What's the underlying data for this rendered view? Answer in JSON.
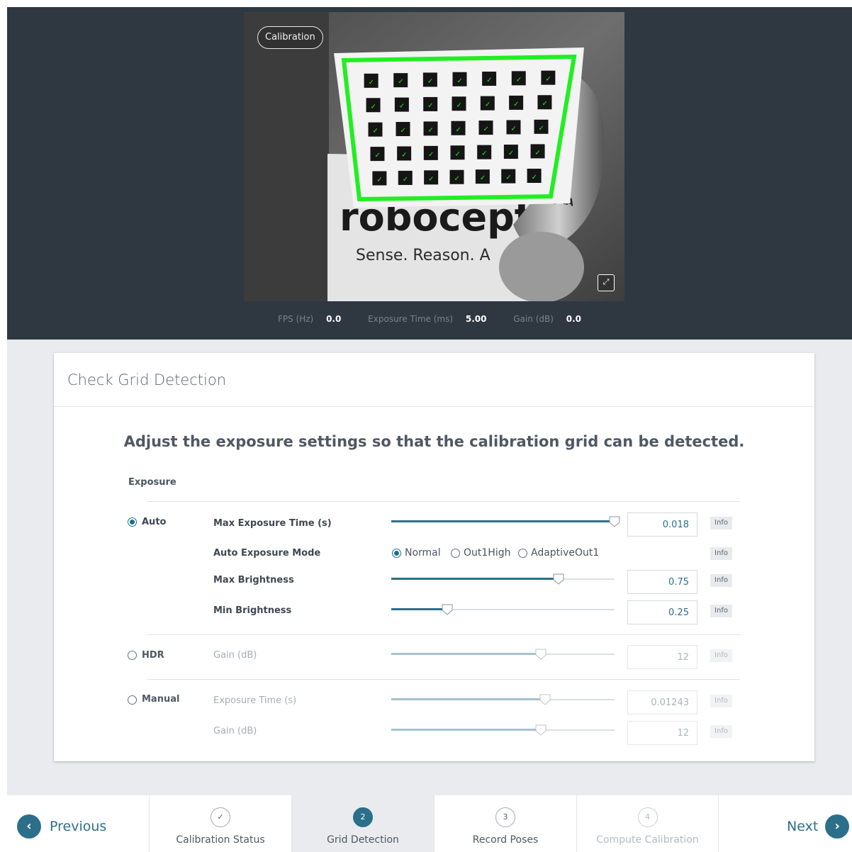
{
  "camera": {
    "badge_label": "Calibration",
    "brand_text": "roboceptio",
    "slogan_text": "Sense. Reason. A",
    "robot_text": "JKA",
    "expand_icon": "expand-icon"
  },
  "stats": {
    "fps_label": "FPS (Hz)",
    "fps_value": "0.0",
    "exposure_label": "Exposure Time (ms)",
    "exposure_value": "5.00",
    "gain_label": "Gain (dB)",
    "gain_value": "0.0"
  },
  "card": {
    "header": "Check Grid Detection",
    "instruction": "Adjust the exposure settings so that the calibration grid can be detected.",
    "exposure_section": "Exposure"
  },
  "modes": {
    "auto": {
      "label": "Auto",
      "selected": true,
      "params": [
        {
          "label": "Max Exposure Time (s)",
          "value": "0.018",
          "fraction": 1.0,
          "info": "Info"
        },
        {
          "label": "Max Brightness",
          "value": "0.75",
          "fraction": 0.75,
          "info": "Info"
        },
        {
          "label": "Min Brightness",
          "value": "0.25",
          "fraction": 0.25,
          "info": "Info"
        }
      ],
      "auto_exposure_mode": {
        "label": "Auto Exposure Mode",
        "options": [
          "Normal",
          "Out1High",
          "AdaptiveOut1"
        ],
        "selected": "Normal",
        "info": "Info"
      }
    },
    "hdr": {
      "label": "HDR",
      "selected": false,
      "params": [
        {
          "label": "Gain (dB)",
          "value": "12",
          "fraction": 0.67,
          "info": "Info"
        }
      ]
    },
    "manual": {
      "label": "Manual",
      "selected": false,
      "params": [
        {
          "label": "Exposure Time (s)",
          "value": "0.01243",
          "fraction": 0.69,
          "info": "Info"
        },
        {
          "label": "Gain (dB)",
          "value": "12",
          "fraction": 0.67,
          "info": "Info"
        }
      ]
    }
  },
  "nav": {
    "previous_label": "Previous",
    "next_label": "Next",
    "steps": [
      {
        "number": "✓",
        "label": "Calibration Status",
        "state": "done"
      },
      {
        "number": "2",
        "label": "Grid Detection",
        "state": "active"
      },
      {
        "number": "3",
        "label": "Record Poses",
        "state": "pending"
      },
      {
        "number": "4",
        "label": "Compute Calibration",
        "state": "disabled"
      }
    ]
  },
  "colors": {
    "accent": "#2b6f8a",
    "dark_bg": "#2f3841",
    "grid_outline": "#22ee22"
  }
}
